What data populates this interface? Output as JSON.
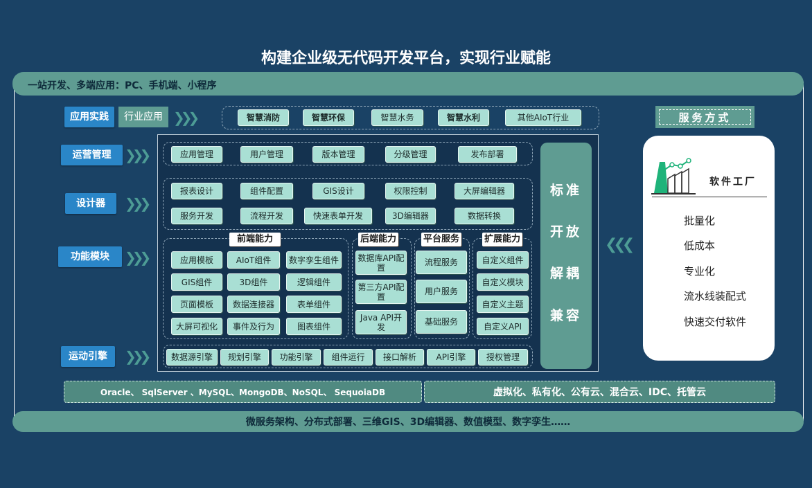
{
  "title": "构建企业级无代码开发平台，实现行业赋能",
  "top_band": "一站开发、多端应用：PC、手机端、小程序",
  "bottom_band": "微服务架构、分布式部署、三维GIS、3D编辑器、数值模型、数字孪生……",
  "row_labels": {
    "practice": "应用实践",
    "industry": "行业应用",
    "ops": "运营管理",
    "designer": "设计器",
    "modules": "功能模块",
    "engine": "运动引擎"
  },
  "industry_items": [
    "智慧消防",
    "智慧环保",
    "智慧水务",
    "智慧水利",
    "其他AIoT行业"
  ],
  "ops_items": [
    "应用管理",
    "用户管理",
    "版本管理",
    "分级管理",
    "发布部署"
  ],
  "designer_items": [
    "报表设计",
    "组件配置",
    "GIS设计",
    "权限控制",
    "大屏编辑器",
    "服务开发",
    "流程开发",
    "快速表单开发",
    "3D编辑器",
    "数据转换"
  ],
  "module_groups": {
    "frontend": {
      "label": "前端能力",
      "items": [
        "应用模板",
        "AIoT组件",
        "数字孪生组件",
        "GIS组件",
        "3D组件",
        "逻辑组件",
        "页面模板",
        "数据连接器",
        "表单组件",
        "大屏可视化",
        "事件及行为",
        "图表组件"
      ]
    },
    "backend": {
      "label": "后端能力",
      "items": [
        "数据库API配置",
        "第三方API配置",
        "Java API开发"
      ]
    },
    "platform": {
      "label": "平台服务",
      "items": [
        "流程服务",
        "用户服务",
        "基础服务"
      ]
    },
    "extension": {
      "label": "扩展能力",
      "items": [
        "自定义组件",
        "自定义模块",
        "自定义主题",
        "自定义API"
      ]
    }
  },
  "engine_items": [
    "数据源引擎",
    "规划引擎",
    "功能引擎",
    "组件运行",
    "接口解析",
    "API引擎",
    "授权管理"
  ],
  "side_column": [
    "标准",
    "开放",
    "解耦",
    "兼容"
  ],
  "service": {
    "label": "服务方式",
    "factory": "软件工厂",
    "items": [
      "批量化",
      "低成本",
      "专业化",
      "流水线装配式",
      "快速交付软件"
    ]
  },
  "db_strip": "Oracle、 SqlServer 、MySQL、MongoDB、NoSQL、 SequoiaDB",
  "deploy_strip": "虚拟化、私有化、公有云、混合云、IDC、托管云",
  "colors": {
    "background": "#1a4265",
    "band": "#5f9c92",
    "chip": "#a9dfd4",
    "label_blue": "#2a86c8",
    "strip": "#508a81"
  }
}
